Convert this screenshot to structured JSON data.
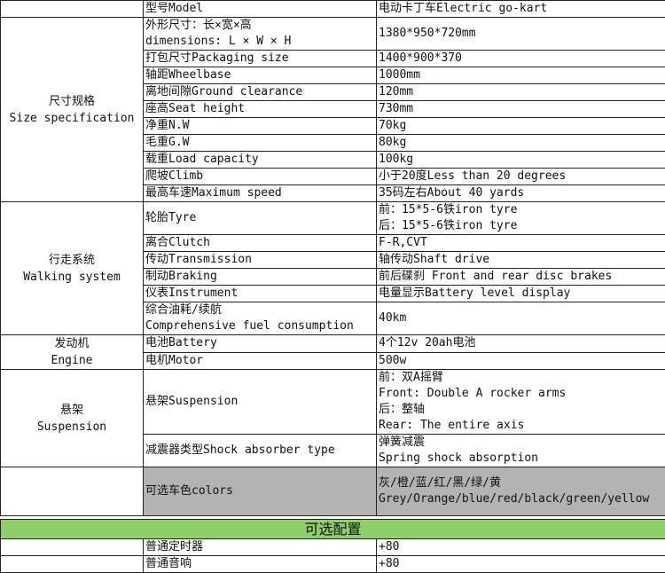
{
  "header": {
    "model_label": "型号Model",
    "model_value": "电动卡丁车Electric go-kart"
  },
  "sections": {
    "size": {
      "title_cn": "尺寸规格",
      "title_en": "Size specification",
      "rows": [
        {
          "label_line1": "外形尺寸：长×宽×高",
          "label_line2": "dimensions: L × W × H",
          "value": "1380*950*720mm"
        },
        {
          "label": "打包尺寸Packaging size",
          "value": "1400*900*370"
        },
        {
          "label": "轴距Wheelbase",
          "value": "1000mm"
        },
        {
          "label": "离地间隙Ground clearance",
          "value": "120mm"
        },
        {
          "label": "座高Seat height",
          "value": "730mm"
        },
        {
          "label": "净重N.W",
          "value": "70kg"
        },
        {
          "label": "毛重G.W",
          "value": "80kg"
        },
        {
          "label": "载重Load capacity",
          "value": "100kg"
        },
        {
          "label": "爬坡Climb",
          "value": "小于20度Less than 20 degrees"
        },
        {
          "label": "最高车速Maximum speed",
          "value": "35码左右About 40 yards"
        }
      ]
    },
    "walking": {
      "title_cn": "行走系统",
      "title_en": "Walking system",
      "rows": [
        {
          "label": "轮胎Tyre",
          "value_line1": "前：15*5-6铁iron tyre",
          "value_line2": "后：15*5-6铁iron tyre"
        },
        {
          "label": "离合Clutch",
          "value": "F-R,CVT"
        },
        {
          "label": "传动Transmission",
          "value": "轴传动Shaft drive"
        },
        {
          "label": "制动Braking",
          "value": "前后碟刹 Front and rear disc brakes"
        },
        {
          "label": "仪表Instrument",
          "value": "电量显示Battery level display"
        },
        {
          "label_line1": "综合油耗/续航",
          "label_line2": "Comprehensive fuel consumption",
          "value": "40km"
        }
      ]
    },
    "engine": {
      "title_cn": "发动机",
      "title_en": "Engine",
      "rows": [
        {
          "label": "电池Battery",
          "value": "4个12v 20ah电池"
        },
        {
          "label": "电机Motor",
          "value": "500w"
        }
      ]
    },
    "suspension": {
      "title_cn": "悬架",
      "title_en": "Suspension",
      "rows": [
        {
          "label": "悬架Suspension",
          "value_lines": [
            "前：双A摇臂",
            "Front: Double A rocker arms",
            "后：整轴",
            "Rear: The entire axis"
          ]
        },
        {
          "label": "减震器类型Shock absorber type",
          "value_line1": "弹簧减震",
          "value_line2": "Spring shock absorption"
        }
      ]
    }
  },
  "colors_row": {
    "label": "可选车色colors",
    "value_line1": "灰/橙/蓝/红/黑/绿/黄",
    "value_line2": "Grey/Orange/blue/red/black/green/yellow"
  },
  "optional": {
    "title": "可选配置",
    "items": [
      {
        "label": "普通定时器",
        "value": "+80"
      },
      {
        "label": "普通音响",
        "value": "+80"
      }
    ]
  },
  "colors": {
    "shade": "#b3b3b3",
    "optional_header": "#8fcf6a"
  }
}
